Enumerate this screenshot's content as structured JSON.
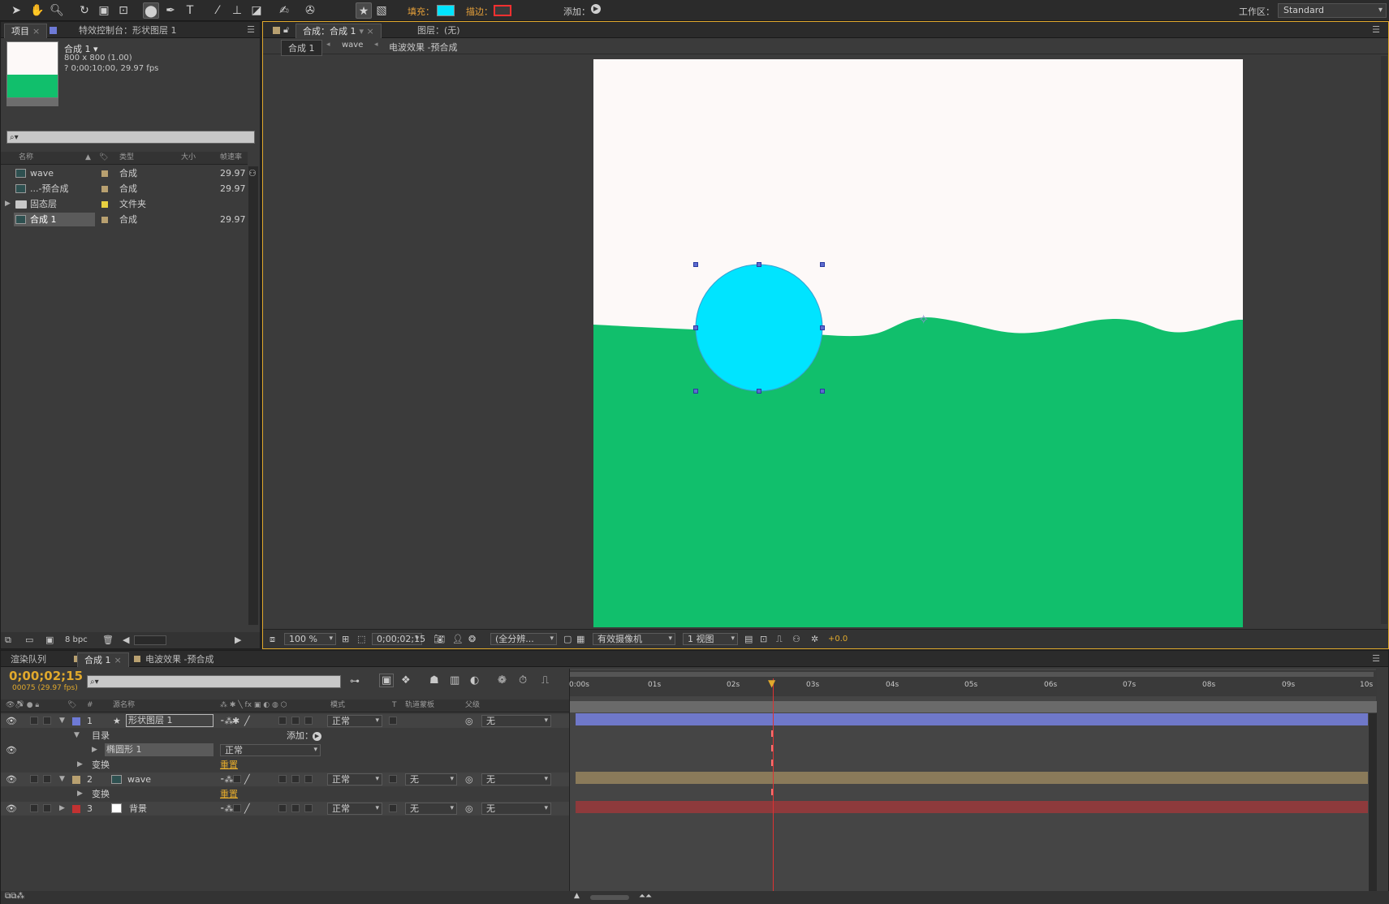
{
  "toolbar": {
    "fill_label": "填充：",
    "stroke_label": "描边：",
    "add_label": "添加：",
    "workspace_label": "工作区：",
    "workspace_value": "Standard",
    "fill_color": "#00e4ff",
    "stroke_color": "#ff3030"
  },
  "project_panel": {
    "tab_project": "项目",
    "tab_effects": "特效控制台：形状图层 1",
    "comp_name": "合成 1 ▾",
    "comp_size": "800 x 800 (1.00)",
    "comp_duration": "? 0;00;10;00, 29.97 fps",
    "columns": {
      "name": "名称",
      "type": "类型",
      "size": "大小",
      "fps": "帧速率"
    },
    "items": [
      {
        "name": "wave",
        "type": "合成",
        "fps": "29.97",
        "chip": "#b8a070",
        "kind": "comp"
      },
      {
        "name": "...-预合成",
        "type": "合成",
        "fps": "29.97",
        "chip": "#b8a070",
        "kind": "comp"
      },
      {
        "name": "固态层",
        "type": "文件夹",
        "fps": "",
        "chip": "#e8d040",
        "kind": "folder"
      },
      {
        "name": "合成 1",
        "type": "合成",
        "fps": "29.97",
        "chip": "#b8a070",
        "kind": "comp"
      }
    ],
    "bpc": "8 bpc"
  },
  "comp_panel": {
    "tab_comp": "合成：合成 1",
    "tab_layer": "图层：(无)",
    "breadcrumbs": [
      "合成 1",
      "wave",
      "电波效果 -预合成"
    ],
    "zoom": "100 %",
    "timecode": "0;00;02;15",
    "resolution": "(全分辨...",
    "camera": "有效摄像机",
    "views": "1 视图",
    "exposure": "+0.0",
    "canvas_bg": "#fdf9f8",
    "wave_color": "#11bf6c",
    "circle_color": "#00e4ff"
  },
  "timeline": {
    "tab_render": "渲染队列",
    "tab_comp": "合成 1",
    "tab_precomp": "电波效果 -预合成",
    "timecode": "0;00;02;15",
    "frame_info": "00075 (29.97 fps)",
    "columns": {
      "source": "源名称",
      "mode": "模式",
      "trkmat": "轨道蒙板",
      "parent": "父级",
      "t": "T"
    },
    "ruler_ticks": [
      "0:00s",
      "01s",
      "02s",
      "03s",
      "04s",
      "05s",
      "06s",
      "07s",
      "08s",
      "09s",
      "10s"
    ],
    "layers": [
      {
        "num": "1",
        "name": "形状图层 1",
        "mode": "正常",
        "parent": "无",
        "label": "#6e7ad6",
        "bar": "#6f78c9"
      },
      {
        "num": "2",
        "name": "wave",
        "mode": "正常",
        "trkmat": "无",
        "parent": "无",
        "label": "#b8a070",
        "bar": "#8a7a5a"
      },
      {
        "num": "3",
        "name": "背景",
        "mode": "正常",
        "trkmat": "无",
        "parent": "无",
        "label": "#c23232",
        "bar": "#8e3a3c"
      }
    ],
    "sub_contents": "目录",
    "sub_add": "添加：",
    "sub_ellipse": "椭圆形 1",
    "sub_ellipse_mode": "正常",
    "sub_transform": "变换",
    "sub_reset": "重置"
  }
}
